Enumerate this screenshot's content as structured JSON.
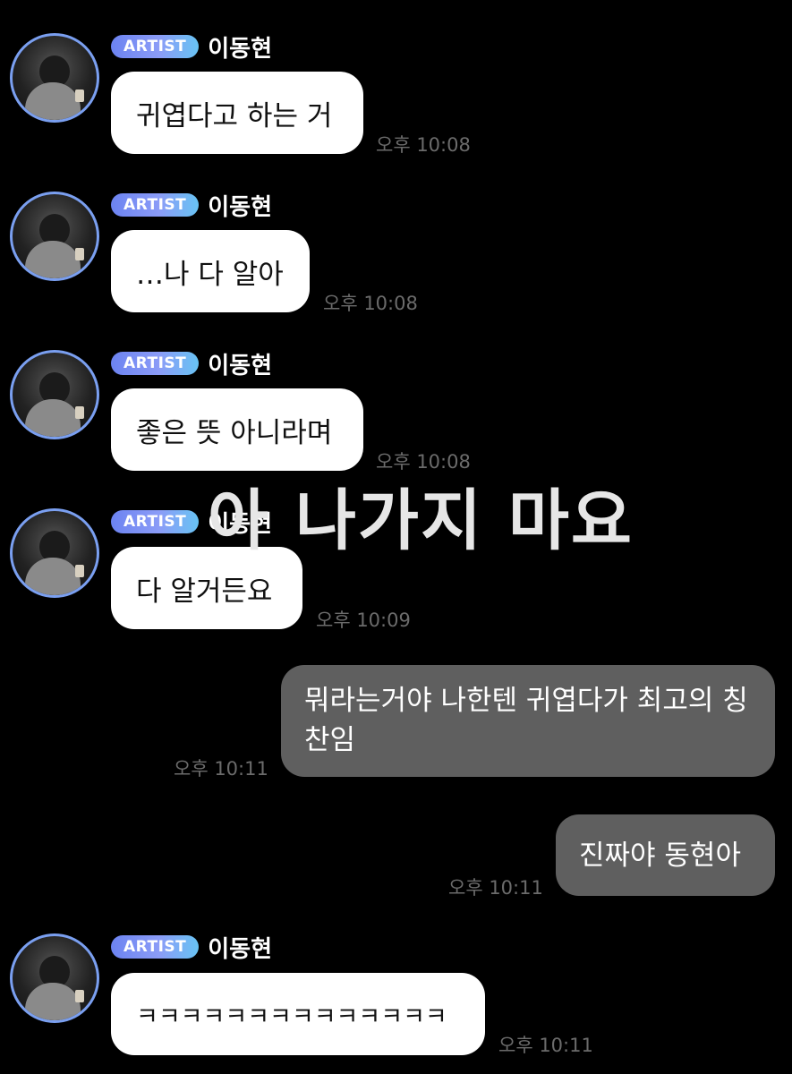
{
  "sender": {
    "badge": "ARTIST",
    "name": "이동현"
  },
  "messages": [
    {
      "direction": "in",
      "text": "귀엽다고 하는 거",
      "time": "오후 10:08"
    },
    {
      "direction": "in",
      "text": "…나 다 알아",
      "time": "오후 10:08"
    },
    {
      "direction": "in",
      "text": "좋은 뜻 아니라며",
      "time": "오후 10:08"
    },
    {
      "direction": "in",
      "text": "다 알거든요",
      "time": "오후 10:09"
    },
    {
      "direction": "out",
      "text": "뭐라는거야 나한텐 귀엽다가 최고의 칭찬임",
      "time": "오후 10:11"
    },
    {
      "direction": "out",
      "text": "진짜야 동현아",
      "time": "오후 10:11"
    },
    {
      "direction": "in",
      "text": "ㅋㅋㅋㅋㅋㅋㅋㅋㅋㅋㅋㅋㅋㅋ",
      "time": "오후 10:11"
    }
  ],
  "overlay_caption": "아 나가지 마요",
  "colors": {
    "background": "#000000",
    "incoming_bubble": "#ffffff",
    "outgoing_bubble": "#5f5f5f",
    "badge_gradient_start": "#6c83f1",
    "badge_gradient_end": "#68c3f3",
    "avatar_ring": "#7a9ff0",
    "timestamp": "#6b6b6b"
  }
}
